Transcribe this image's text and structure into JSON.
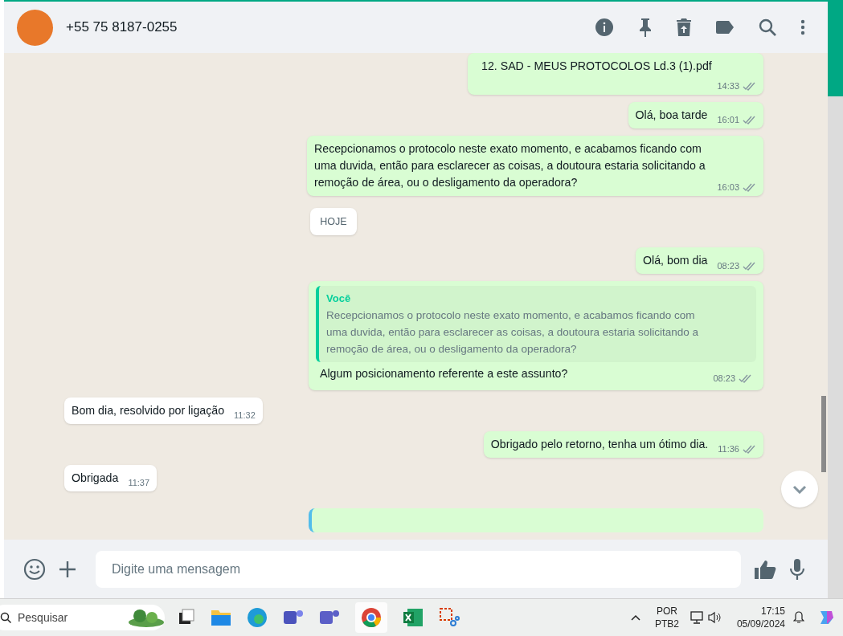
{
  "header": {
    "contact": "+55 75 8187-0255"
  },
  "messages": [
    {
      "kind": "file",
      "outgoing": true,
      "text": "12. SAD - MEUS PROTOCOLOS Ld.3 (1).pdf",
      "time": "14:33",
      "read": true
    },
    {
      "kind": "text",
      "outgoing": true,
      "text": "Olá, boa tarde",
      "time": "16:01",
      "read": true
    },
    {
      "kind": "text",
      "outgoing": true,
      "text": "Recepcionamos o protocolo neste exato momento, e acabamos ficando com uma duvida, então para esclarecer as coisas, a doutoura estaria solicitando a remoção de área, ou o desligamento da operadora?",
      "time": "16:03",
      "read": true
    },
    {
      "kind": "date",
      "text": "HOJE"
    },
    {
      "kind": "text",
      "outgoing": true,
      "text": "Olá, bom dia",
      "time": "08:23",
      "read": true
    },
    {
      "kind": "reply",
      "outgoing": true,
      "quote_author": "Você",
      "quote": "Recepcionamos o protocolo neste exato momento, e acabamos ficando com uma duvida, então para esclarecer as coisas, a doutoura estaria solicitando a remoção de área, ou o desligamento da operadora?",
      "text": "Algum posicionamento referente a este assunto?",
      "time": "08:23",
      "read": true
    },
    {
      "kind": "text",
      "outgoing": false,
      "text": "Bom dia, resolvido por ligação",
      "time": "11:32"
    },
    {
      "kind": "text",
      "outgoing": true,
      "text": "Obrigado pelo retorno, tenha um ótimo dia.",
      "time": "11:36",
      "read": true
    },
    {
      "kind": "text",
      "outgoing": false,
      "text": "Obrigada",
      "time": "11:37"
    }
  ],
  "composer": {
    "placeholder": "Digite uma mensagem"
  },
  "taskbar": {
    "search_placeholder": "Pesquisar",
    "language": "POR",
    "layout": "PTB2",
    "time": "17:15",
    "date": "05/09/2024"
  }
}
